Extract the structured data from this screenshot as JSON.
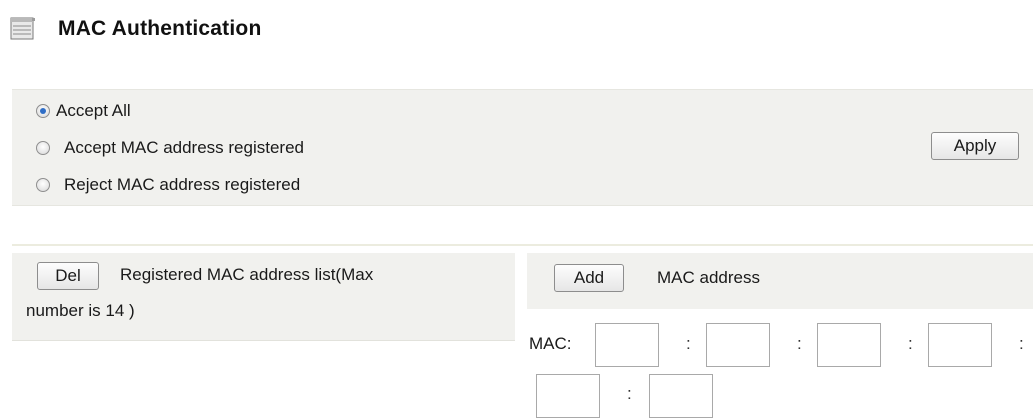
{
  "header": {
    "title": "MAC Authentication",
    "icon": "server-icon"
  },
  "mode": {
    "options": [
      {
        "label": "Accept All",
        "checked": true
      },
      {
        "label": "Accept MAC address registered",
        "checked": false
      },
      {
        "label": "Reject MAC address registered",
        "checked": false
      }
    ],
    "apply_label": "Apply"
  },
  "list": {
    "delete_label": "Del",
    "title_line1": "Registered MAC address list(Max",
    "title_line2": "number is 14 )"
  },
  "add": {
    "add_label": "Add",
    "title": "MAC address",
    "mac_label": "MAC:",
    "separator": ":",
    "fields": [
      "",
      "",
      "",
      "",
      "",
      ""
    ]
  },
  "colors": {
    "panel_bg": "#f1f1ee",
    "radio_selected": "#2f6ec6"
  }
}
